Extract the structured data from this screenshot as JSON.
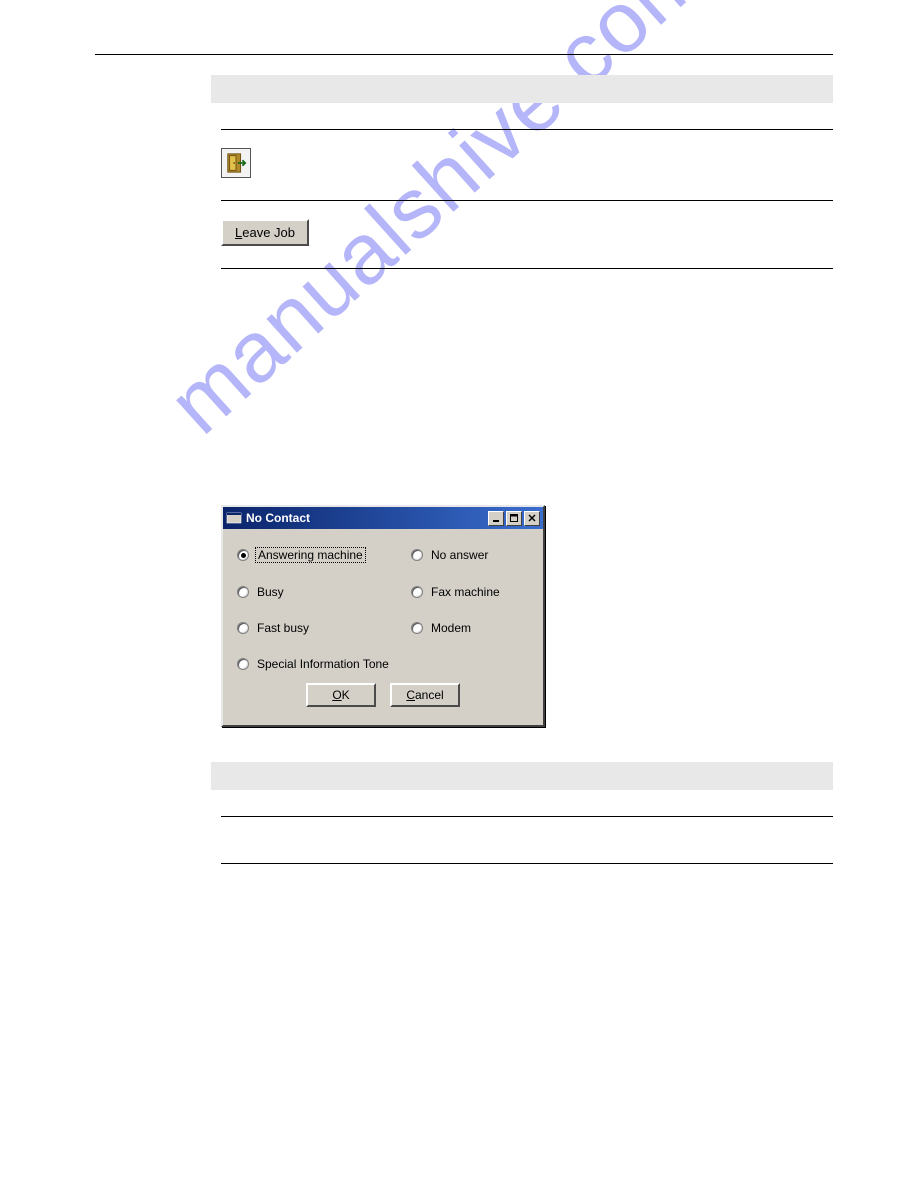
{
  "watermark": "manualshive.com",
  "leave_job_button": {
    "prefix": "L",
    "rest": "eave Job"
  },
  "dialog": {
    "title": "No Contact",
    "options": [
      {
        "label": "Answering machine",
        "checked": true
      },
      {
        "label": "No answer",
        "checked": false
      },
      {
        "label": "Busy",
        "checked": false
      },
      {
        "label": "Fax machine",
        "checked": false
      },
      {
        "label": "Fast busy",
        "checked": false
      },
      {
        "label": "Modem",
        "checked": false
      },
      {
        "label": "Special Information Tone",
        "checked": false,
        "full": true
      }
    ],
    "ok": {
      "prefix": "O",
      "rest": "K"
    },
    "cancel": {
      "prefix": "C",
      "rest": "ancel"
    }
  }
}
